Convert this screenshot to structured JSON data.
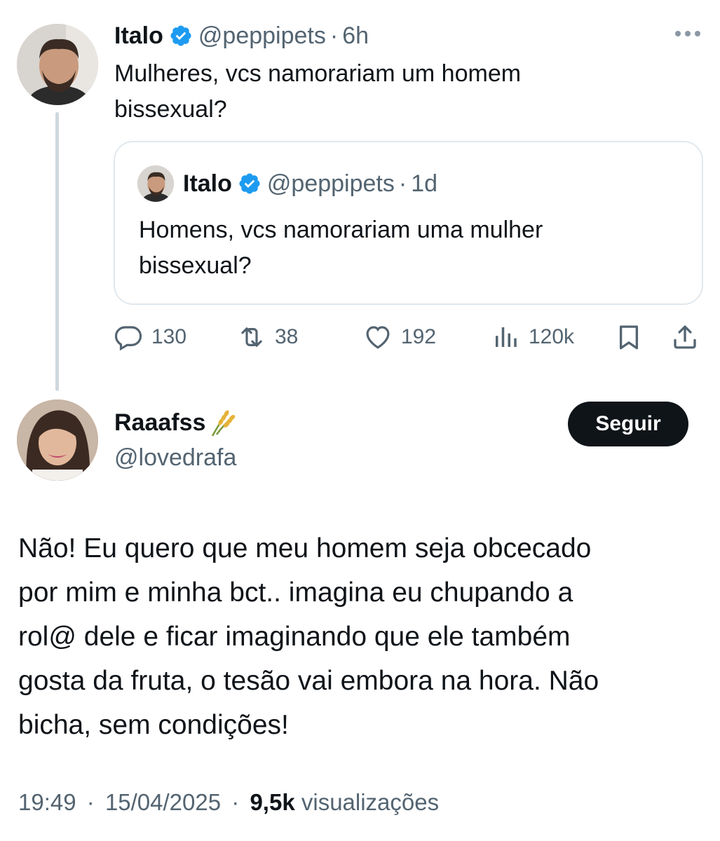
{
  "parent_tweet": {
    "author_name": "Italo",
    "handle": "@peppipets",
    "time": "6h",
    "text": "Mulheres, vcs namorariam um homem\nbissexual?",
    "quoted_tweet": {
      "author_name": "Italo",
      "handle": "@peppipets",
      "time": "1d",
      "text": "Homens, vcs namorariam uma mulher\nbissexual?"
    },
    "stats": {
      "replies": "130",
      "retweets": "38",
      "likes": "192",
      "views": "120k"
    }
  },
  "reply_tweet": {
    "author_name": "Raaafss",
    "handle": "@lovedrafa",
    "follow_label": "Seguir",
    "text": "Não! Eu quero que meu homem seja obcecado\npor mim e minha bct.. imagina eu chupando a\nrol@ dele e ficar imaginando que ele também\ngosta da fruta, o tesão vai embora na hora. Não\nbicha, sem condições!",
    "time": "19:49",
    "date": "15/04/2025",
    "views_count": "9,5k",
    "views_label": "visualizações"
  },
  "separator": "·",
  "icons": {
    "verified": "verified-badge-icon",
    "more": "more-icon",
    "reply": "reply-icon",
    "retweet": "retweet-icon",
    "like": "heart-icon",
    "views": "views-icon",
    "bookmark": "bookmark-icon",
    "share": "share-icon",
    "name_emoji": "rice-icon"
  },
  "colors": {
    "verified": "#1d9bf0",
    "text": "#0f1419",
    "muted": "#536471",
    "border": "#e1e8ed",
    "follow_bg": "#0f1419"
  }
}
